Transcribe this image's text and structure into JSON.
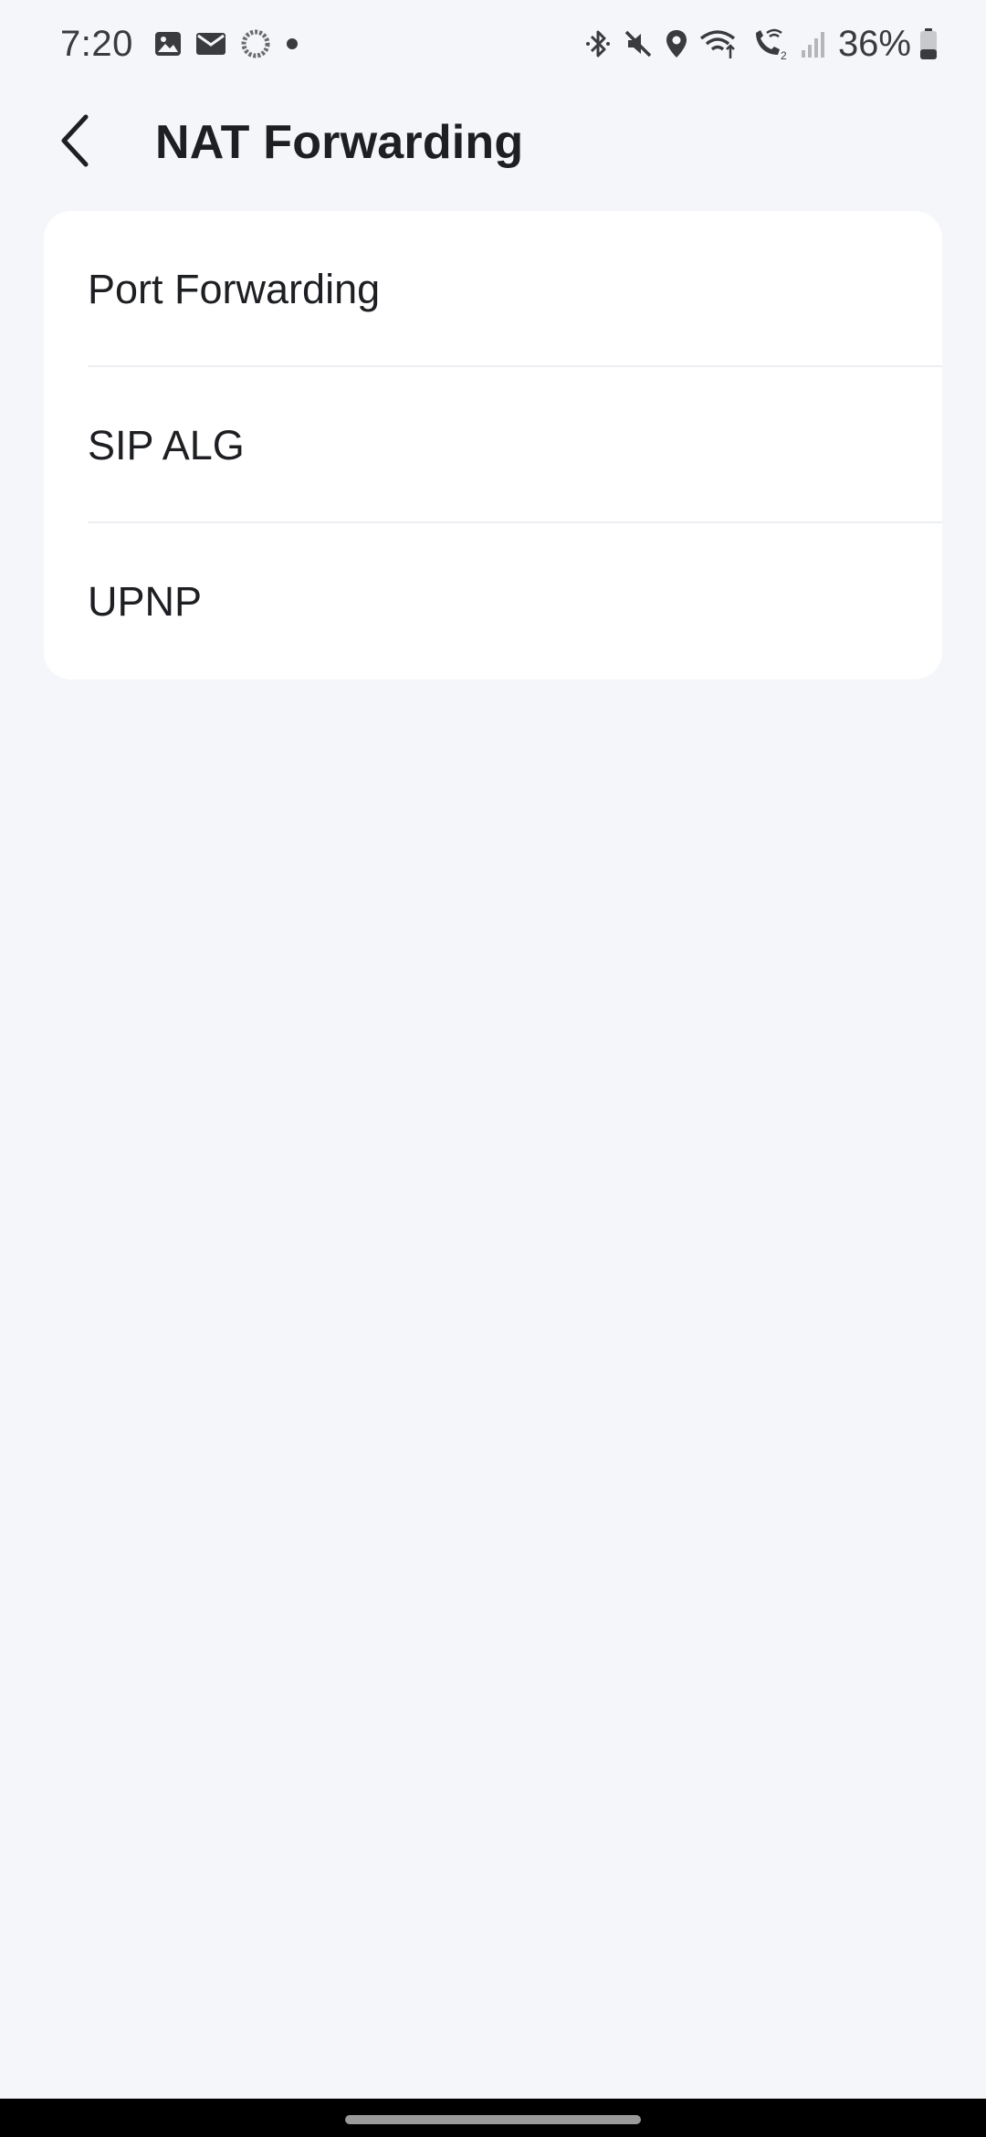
{
  "status_bar": {
    "time": "7:20",
    "battery_percent": "36%",
    "battery_level": 0.36,
    "left_icons": [
      "gallery-icon",
      "mail-icon",
      "sync-icon",
      "dot-icon"
    ],
    "right_icons": [
      "bluetooth-icon",
      "mute-icon",
      "location-icon",
      "wifi-icon",
      "wifi-call-icon",
      "signal-icon",
      "battery-icon"
    ]
  },
  "app_bar": {
    "title": "NAT Forwarding",
    "back_icon": "chevron-left-icon"
  },
  "menu": {
    "items": [
      {
        "label": "Port Forwarding"
      },
      {
        "label": "SIP ALG"
      },
      {
        "label": "UPNP"
      }
    ]
  },
  "colors": {
    "background": "#f4f6fa",
    "card": "#ffffff",
    "text": "#1e1f22",
    "divider": "#eceef2",
    "nav_bar": "#000000"
  }
}
